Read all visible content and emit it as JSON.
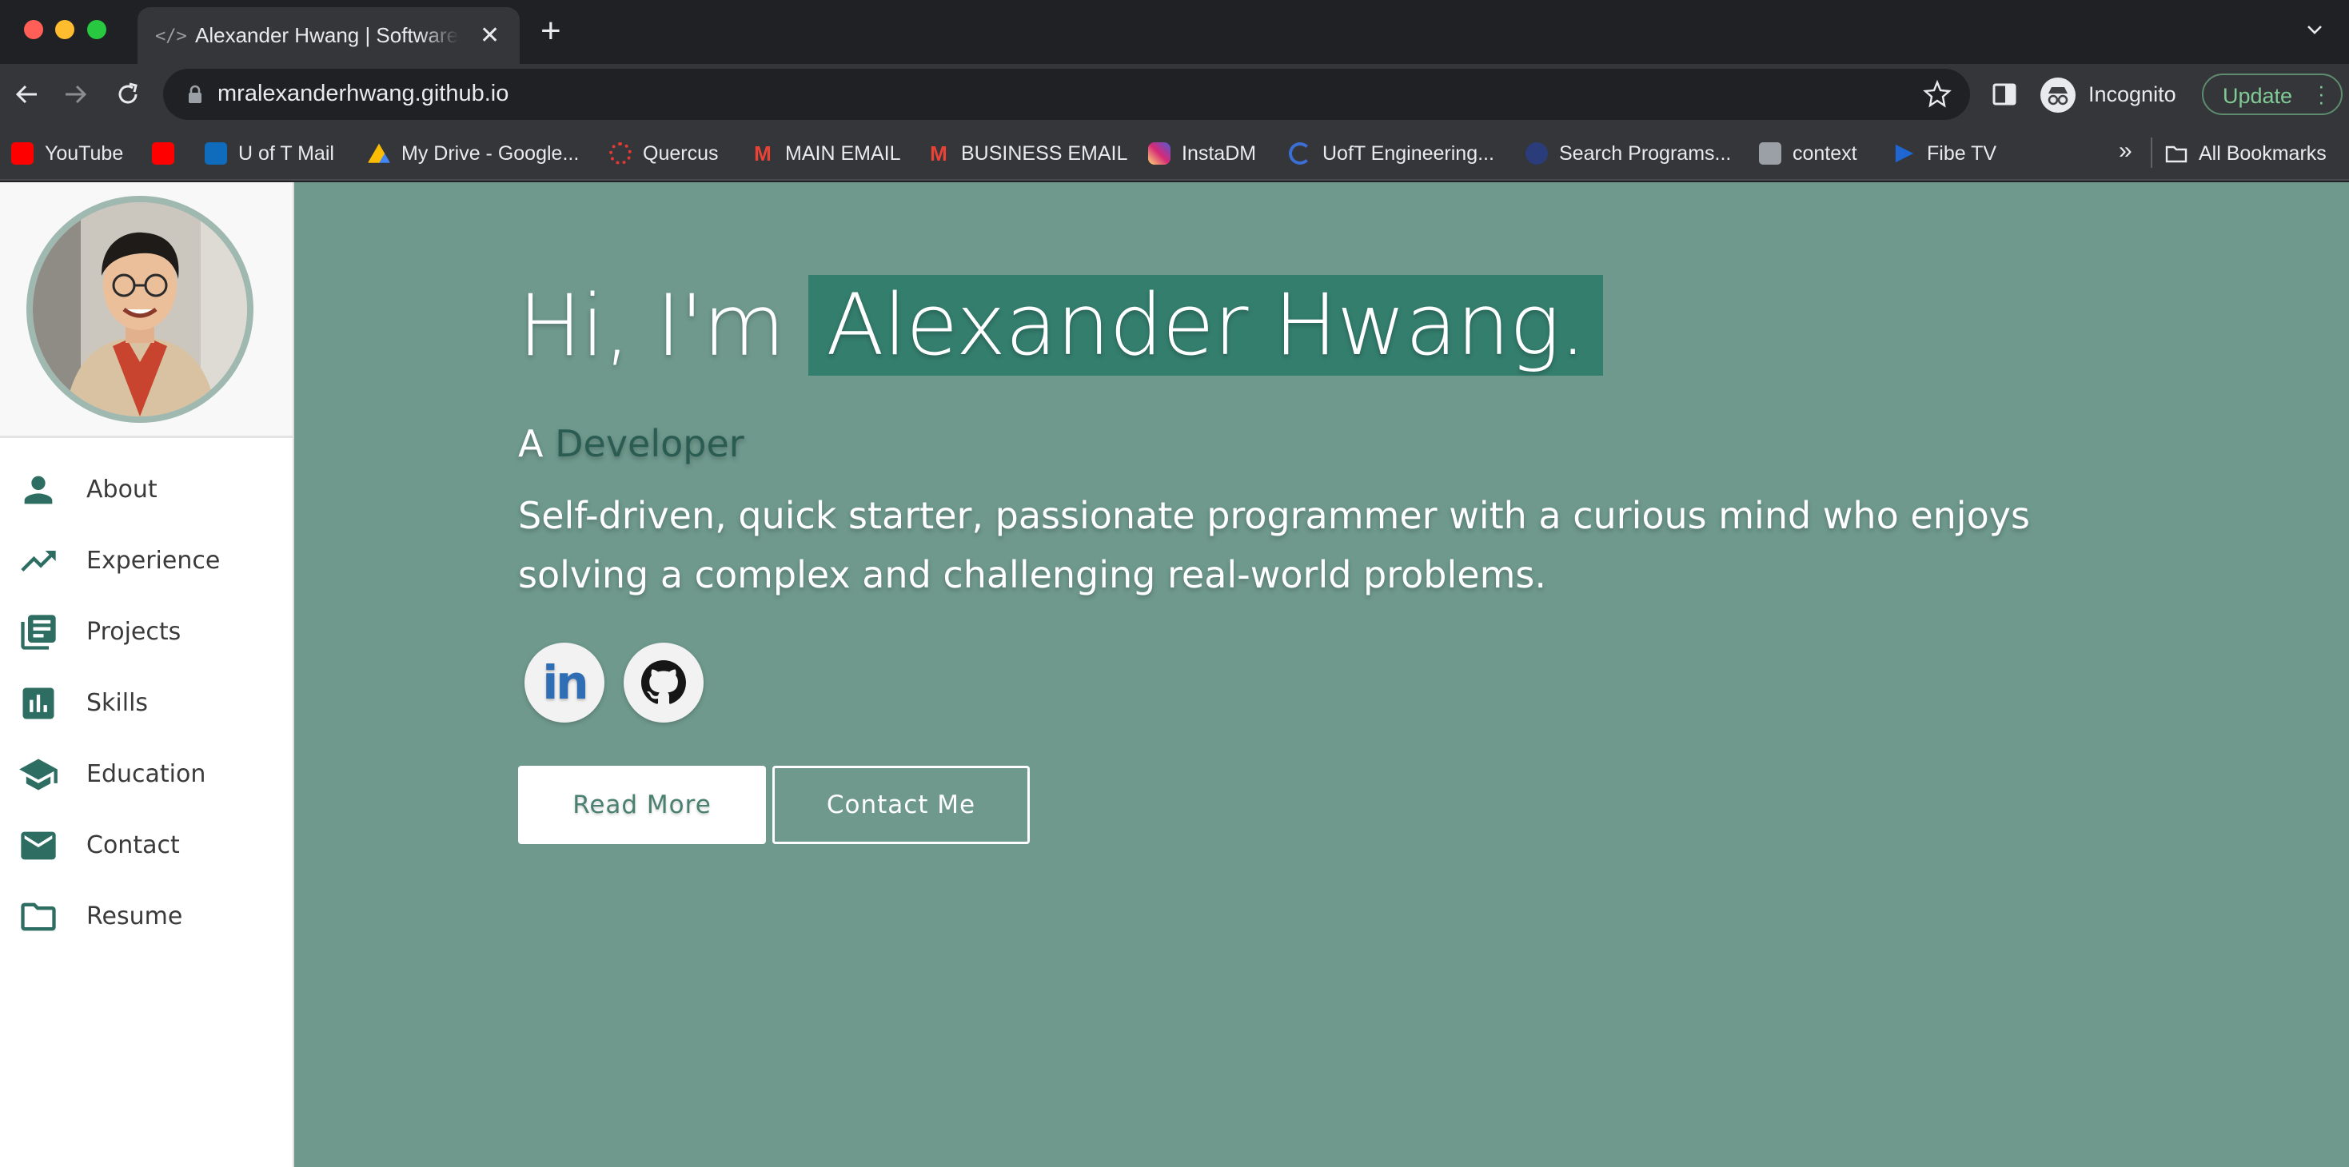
{
  "browser": {
    "tab": {
      "title": "Alexander Hwang | Software Developer",
      "icon": "code-icon"
    },
    "url": "mralexanderhwang.github.io",
    "profile_label": "Incognito",
    "update_label": "Update",
    "bookmarks": [
      {
        "label": "YouTube",
        "icon": "youtube-icon",
        "color": "#ff0000"
      },
      {
        "label": "",
        "icon": "youtube-icon",
        "color": "#ff0000"
      },
      {
        "label": "U of T Mail",
        "icon": "outlook-icon",
        "color": "#0f6cbd"
      },
      {
        "label": "My Drive - Google...",
        "icon": "google-drive-icon",
        "color": "#fbbc04"
      },
      {
        "label": "Quercus",
        "icon": "quercus-icon",
        "color": "#e53935"
      },
      {
        "label": "MAIN EMAIL",
        "icon": "gmail-icon",
        "color": "#ea4335"
      },
      {
        "label": "BUSINESS EMAIL",
        "icon": "gmail-icon",
        "color": "#ea4335"
      },
      {
        "label": "InstaDM",
        "icon": "instagram-icon",
        "color": "#d62976"
      },
      {
        "label": "UofT Engineering...",
        "icon": "uoft-engineering-icon",
        "color": "#3b6fd4"
      },
      {
        "label": "Search Programs...",
        "icon": "globe-icon",
        "color": "#2a3d7a"
      },
      {
        "label": "context",
        "icon": "context-icon",
        "color": "#9aa0a6"
      },
      {
        "label": "Fibe TV",
        "icon": "fibe-tv-icon",
        "color": "#1f66d1"
      }
    ],
    "more_label": "»",
    "all_bookmarks_label": "All Bookmarks"
  },
  "sidebar": {
    "items": [
      {
        "label": "About",
        "icon": "person-icon"
      },
      {
        "label": "Experience",
        "icon": "trending-up-icon"
      },
      {
        "label": "Projects",
        "icon": "library-books-icon"
      },
      {
        "label": "Skills",
        "icon": "bar-chart-icon"
      },
      {
        "label": "Education",
        "icon": "graduation-cap-icon"
      },
      {
        "label": "Contact",
        "icon": "mail-icon"
      },
      {
        "label": "Resume",
        "icon": "folder-icon"
      }
    ]
  },
  "hero": {
    "greeting_prefix": "Hi, I'm",
    "name": "Alexander Hwang.",
    "role_prefix": "A",
    "role": "Developer",
    "tagline": "Self-driven, quick starter, passionate programmer with a curious mind who enjoys solving a complex and challenging real-world problems.",
    "socials": [
      {
        "name": "LinkedIn",
        "label": "in",
        "icon": "linkedin-icon"
      },
      {
        "name": "GitHub",
        "icon": "github-icon"
      }
    ],
    "read_more_label": "Read More",
    "contact_label": "Contact Me"
  },
  "colors": {
    "page_background": "#6f998d",
    "name_highlight": "#347e6e",
    "accent": "#2e6e62"
  }
}
